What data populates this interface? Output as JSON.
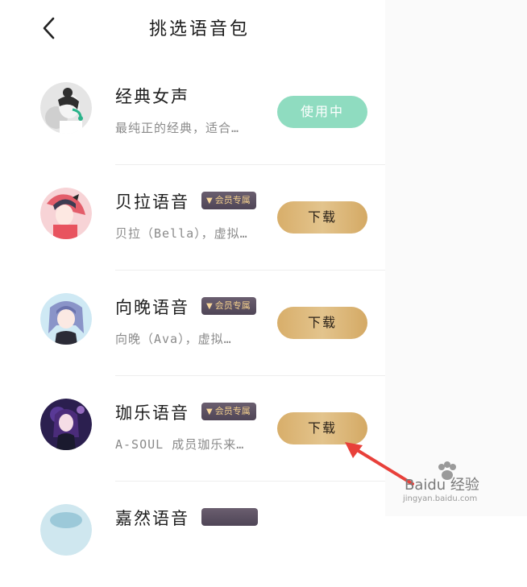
{
  "header": {
    "title": "挑选语音包"
  },
  "items": [
    {
      "name": "经典女声",
      "desc": "最纯正的经典，适合…",
      "badge": "",
      "button": "使用中",
      "button_state": "in-use"
    },
    {
      "name": "贝拉语音",
      "desc": "贝拉（Bella），虚拟…",
      "badge": "会员专属",
      "button": "下载",
      "button_state": "download"
    },
    {
      "name": "向晚语音",
      "desc": "向晚（Ava），虚拟…",
      "badge": "会员专属",
      "button": "下载",
      "button_state": "download"
    },
    {
      "name": "珈乐语音",
      "desc": "A-SOUL 成员珈乐来…",
      "badge": "会员专属",
      "button": "下载",
      "button_state": "download"
    },
    {
      "name": "嘉然语音",
      "desc": "",
      "badge": "",
      "button": "",
      "button_state": ""
    }
  ],
  "watermark": {
    "line1": "Baidu 经验",
    "line2": "jingyan.baidu.com"
  },
  "colors": {
    "in_use": "#8fdcc0",
    "download_gold": "#e3c48d",
    "badge_bg": "#5b5062",
    "badge_text": "#f3cf8d",
    "arrow": "#e8403a"
  }
}
